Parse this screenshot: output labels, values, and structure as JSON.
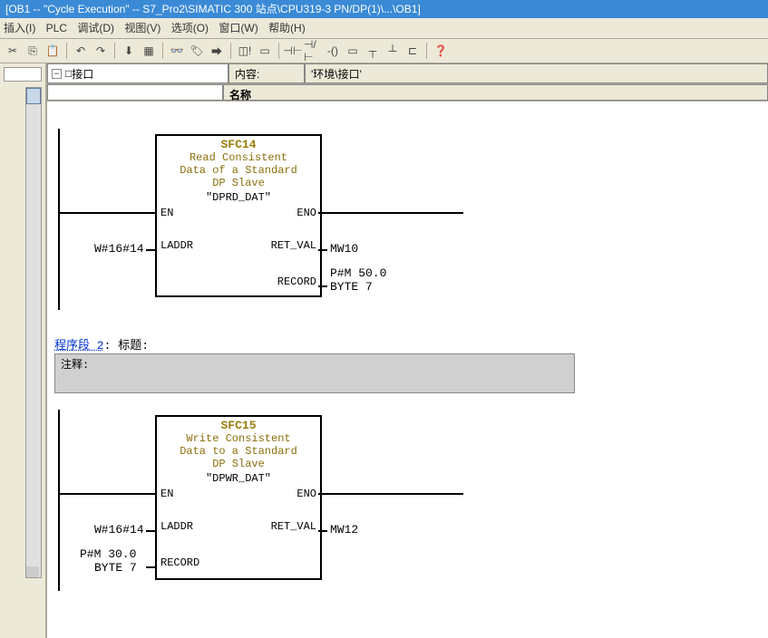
{
  "title": "[OB1 -- \"Cycle Execution\" -- S7_Pro2\\SIMATIC 300 站点\\CPU319-3 PN/DP(1)\\...\\OB1]",
  "menu": {
    "m1": "插入(I)",
    "m2": "PLC",
    "m3": "调试(D)",
    "m4": "视图(V)",
    "m5": "选项(O)",
    "m6": "窗口(W)",
    "m7": "帮助(H)"
  },
  "header": {
    "content_label": "内容:",
    "content_value": "'环境\\接口'",
    "interface": "接口",
    "name": "名称"
  },
  "block1": {
    "sfc": "SFC14",
    "l1": "Read Consistent",
    "l2": "Data of a Standard",
    "l3": "DP Slave",
    "sym": "\"DPRD_DAT\"",
    "en": "EN",
    "eno": "ENO",
    "laddr": "LADDR",
    "retval": "RET_VAL",
    "record": "RECORD",
    "in_laddr": "W#16#14",
    "out_retval": "MW10",
    "out_rec1": "P#M 50.0",
    "out_rec2": "BYTE 7"
  },
  "seg2": {
    "prefix": "程序段 2",
    "title": ": 标题:",
    "comment": "注释:"
  },
  "block2": {
    "sfc": "SFC15",
    "l1": "Write Consistent",
    "l2": "Data to a Standard",
    "l3": "DP Slave",
    "sym": "\"DPWR_DAT\"",
    "en": "EN",
    "eno": "ENO",
    "laddr": "LADDR",
    "retval": "RET_VAL",
    "record": "RECORD",
    "in_laddr": "W#16#14",
    "in_rec1": "P#M 30.0",
    "in_rec2": "BYTE 7",
    "out_retval": "MW12"
  }
}
